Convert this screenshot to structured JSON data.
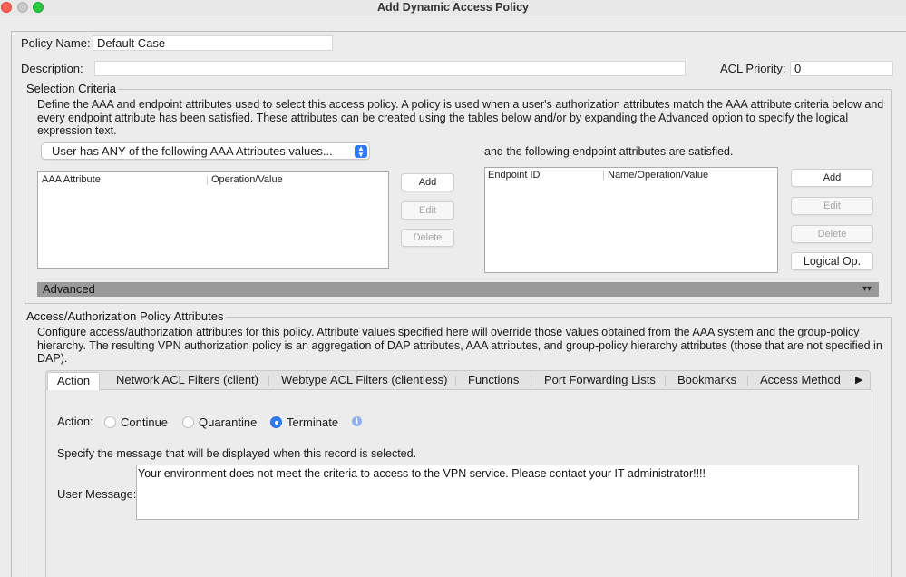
{
  "window": {
    "title": "Add Dynamic Access Policy",
    "colors": {
      "close": "#ff5f57",
      "minimize": "#c9c9c9",
      "maximize": "#28c840"
    }
  },
  "policy": {
    "name_label": "Policy Name:",
    "name_value": "Default Case",
    "description_label": "Description:",
    "description_value": "",
    "acl_priority_label": "ACL Priority:",
    "acl_priority_value": "0"
  },
  "selection": {
    "legend": "Selection Criteria",
    "description": "Define the AAA and endpoint attributes used to select this access policy. A policy is used when a user's authorization attributes match the AAA attribute criteria below and every endpoint attribute has been satisfied. These attributes can be created using the tables below and/or by expanding the Advanced option to specify the logical expression text.",
    "aaa_match_select": "User has ANY of the following AAA Attributes values...",
    "aaa_table": {
      "columns": [
        "AAA Attribute",
        "Operation/Value"
      ],
      "rows": []
    },
    "aaa_buttons": {
      "add": "Add",
      "edit": "Edit",
      "delete": "Delete"
    },
    "endpoint_caption": "and the following endpoint attributes are satisfied.",
    "endpoint_table": {
      "columns": [
        "Endpoint ID",
        "Name/Operation/Value"
      ],
      "rows": []
    },
    "endpoint_buttons": {
      "add": "Add",
      "edit": "Edit",
      "delete": "Delete",
      "logical_op": "Logical Op."
    },
    "advanced_label": "Advanced"
  },
  "access": {
    "legend": "Access/Authorization Policy Attributes",
    "description": "Configure access/authorization attributes for this policy. Attribute values specified here will override those values obtained from the AAA system and the group-policy hierarchy. The resulting VPN authorization policy is an aggregation of DAP attributes, AAA attributes, and group-policy hierarchy attributes (those that are not specified in DAP).",
    "tabs": [
      "Action",
      "Network ACL Filters (client)",
      "Webtype ACL Filters (clientless)",
      "Functions",
      "Port Forwarding Lists",
      "Bookmarks",
      "Access Method"
    ],
    "active_tab": "Action",
    "action": {
      "label": "Action:",
      "options": [
        "Continue",
        "Quarantine",
        "Terminate"
      ],
      "selected": "Terminate",
      "message_hint": "Specify the message that will be displayed when this record is selected.",
      "user_message_label": "User Message:",
      "user_message_value": "Your environment does not meet the criteria to access to the VPN service. Please contact your IT administrator!!!!"
    }
  }
}
